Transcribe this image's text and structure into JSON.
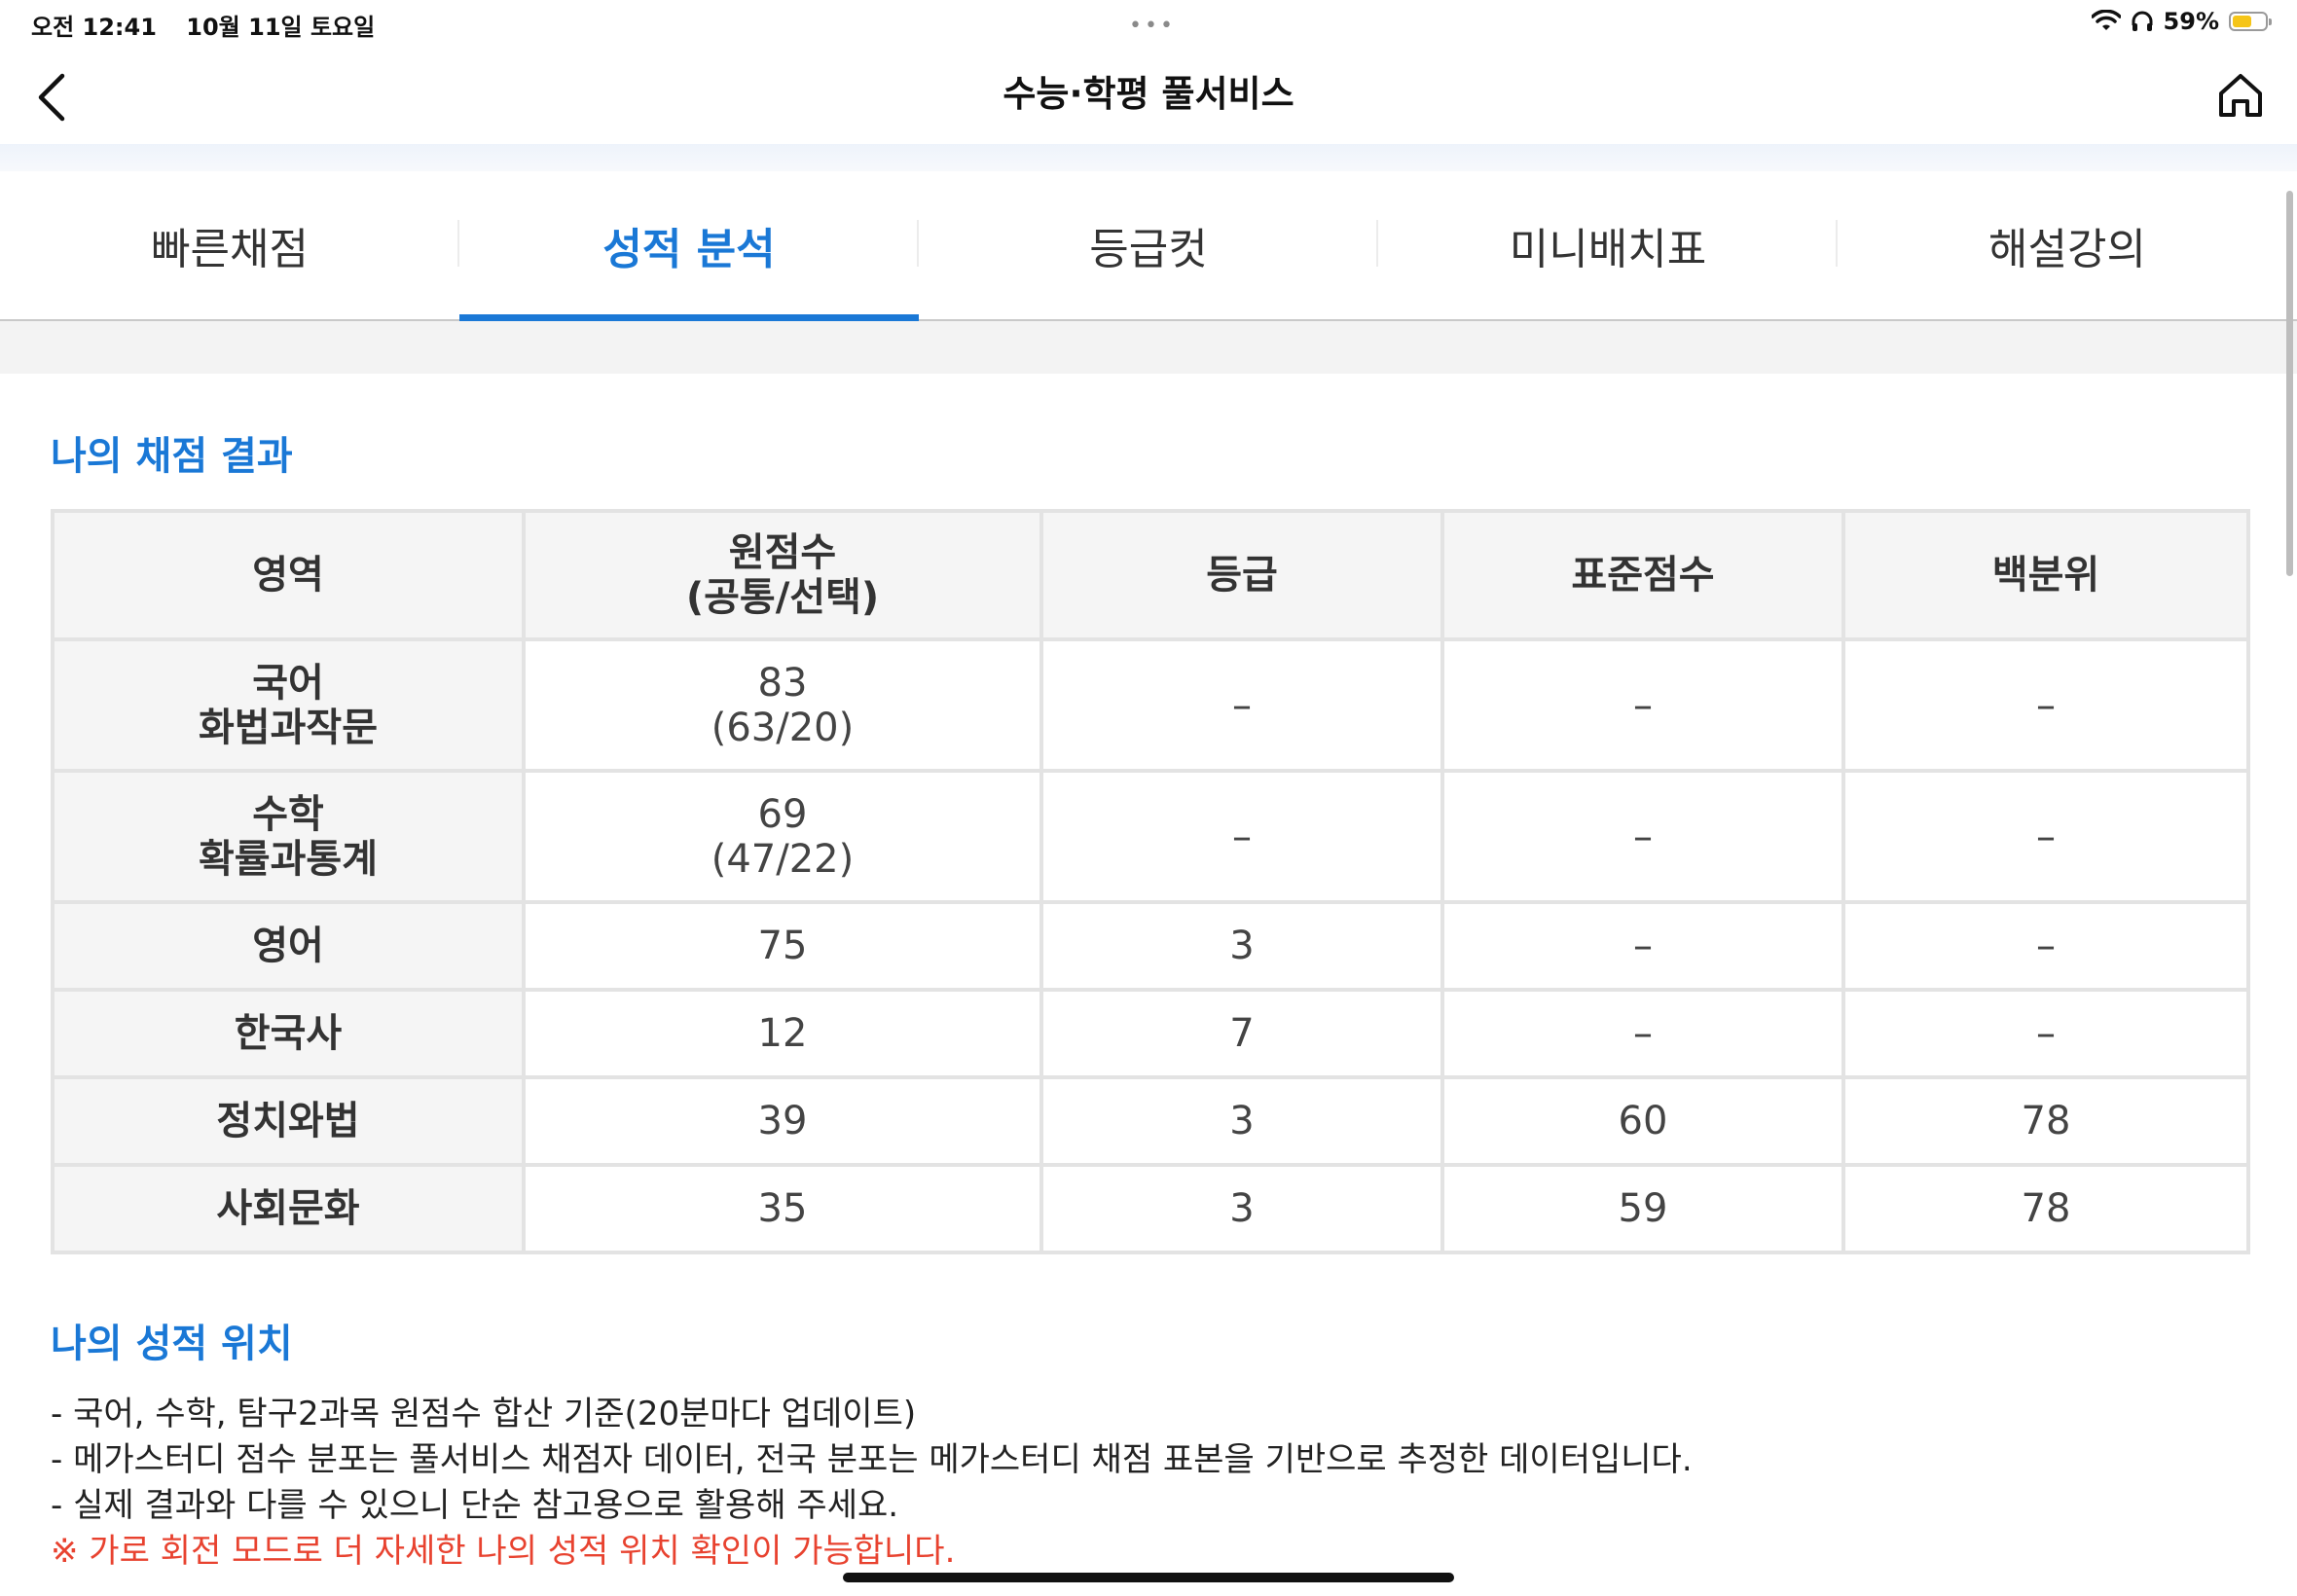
{
  "status_bar": {
    "time": "오전 12:41",
    "date": "10월 11일 토요일",
    "battery": "59%",
    "battery_level": 0.59
  },
  "nav": {
    "title": "수능·학평 풀서비스",
    "back_icon": "chevron-left-icon",
    "home_icon": "home-icon"
  },
  "tabs": [
    {
      "label": "빠른채점",
      "active": false
    },
    {
      "label": "성적 분석",
      "active": true
    },
    {
      "label": "등급컷",
      "active": false
    },
    {
      "label": "미니배치표",
      "active": false
    },
    {
      "label": "해설강의",
      "active": false
    }
  ],
  "accent_color": "#1a78d6",
  "results": {
    "title": "나의 채점 결과",
    "headers": {
      "area": "영역",
      "raw_line1": "원점수",
      "raw_line2": "(공통/선택)",
      "grade": "등급",
      "standard": "표준점수",
      "percentile": "백분위"
    },
    "rows": [
      {
        "area": "국어",
        "sub": "화법과작문",
        "raw": "83",
        "raw_detail": "(63/20)",
        "grade": "–",
        "standard": "–",
        "percentile": "–"
      },
      {
        "area": "수학",
        "sub": "확률과통계",
        "raw": "69",
        "raw_detail": "(47/22)",
        "grade": "–",
        "standard": "–",
        "percentile": "–"
      },
      {
        "area": "영어",
        "raw": "75",
        "grade": "3",
        "standard": "–",
        "percentile": "–"
      },
      {
        "area": "한국사",
        "raw": "12",
        "grade": "7",
        "standard": "–",
        "percentile": "–"
      },
      {
        "area": "정치와법",
        "raw": "39",
        "grade": "3",
        "standard": "60",
        "percentile": "78"
      },
      {
        "area": "사회문화",
        "raw": "35",
        "grade": "3",
        "standard": "59",
        "percentile": "78"
      }
    ]
  },
  "position": {
    "title": "나의 성적 위치",
    "notes": [
      "- 국어, 수학, 탐구2과목 원점수 합산 기준(20분마다 업데이트)",
      "- 메가스터디 점수 분포는 풀서비스 채점자 데이터, 전국 분포는 메가스터디 채점 표본을 기반으로 추정한 데이터입니다.",
      "- 실제 결과와 다를 수 있으니 단순 참고용으로 활용해 주세요."
    ],
    "warning": "※ 가로 회전 모드로 더 자세한 나의 성적 위치 확인이 가능합니다."
  }
}
